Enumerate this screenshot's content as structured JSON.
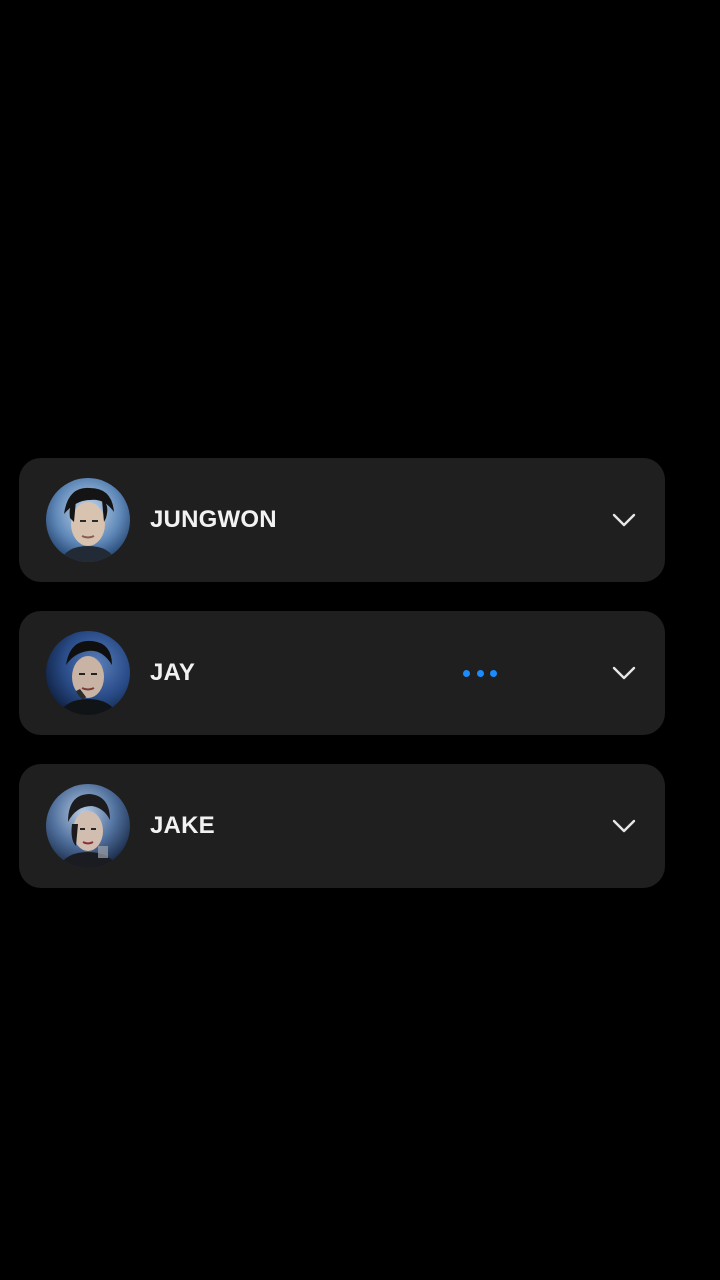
{
  "colors": {
    "background": "#000000",
    "card": "#1f1f1f",
    "text": "#f2f2f2",
    "typing_dots": "#1a8cff",
    "chevron": "#e6e6e6"
  },
  "chats": [
    {
      "name": "JUNGWON",
      "avatar": "avatar-photo",
      "typing": false,
      "expand_icon": "chevron-down-icon"
    },
    {
      "name": "JAY",
      "avatar": "avatar-photo",
      "typing": true,
      "typing_icon": "typing-dots-icon",
      "expand_icon": "chevron-down-icon"
    },
    {
      "name": "JAKE",
      "avatar": "avatar-photo",
      "typing": false,
      "expand_icon": "chevron-down-icon"
    }
  ]
}
